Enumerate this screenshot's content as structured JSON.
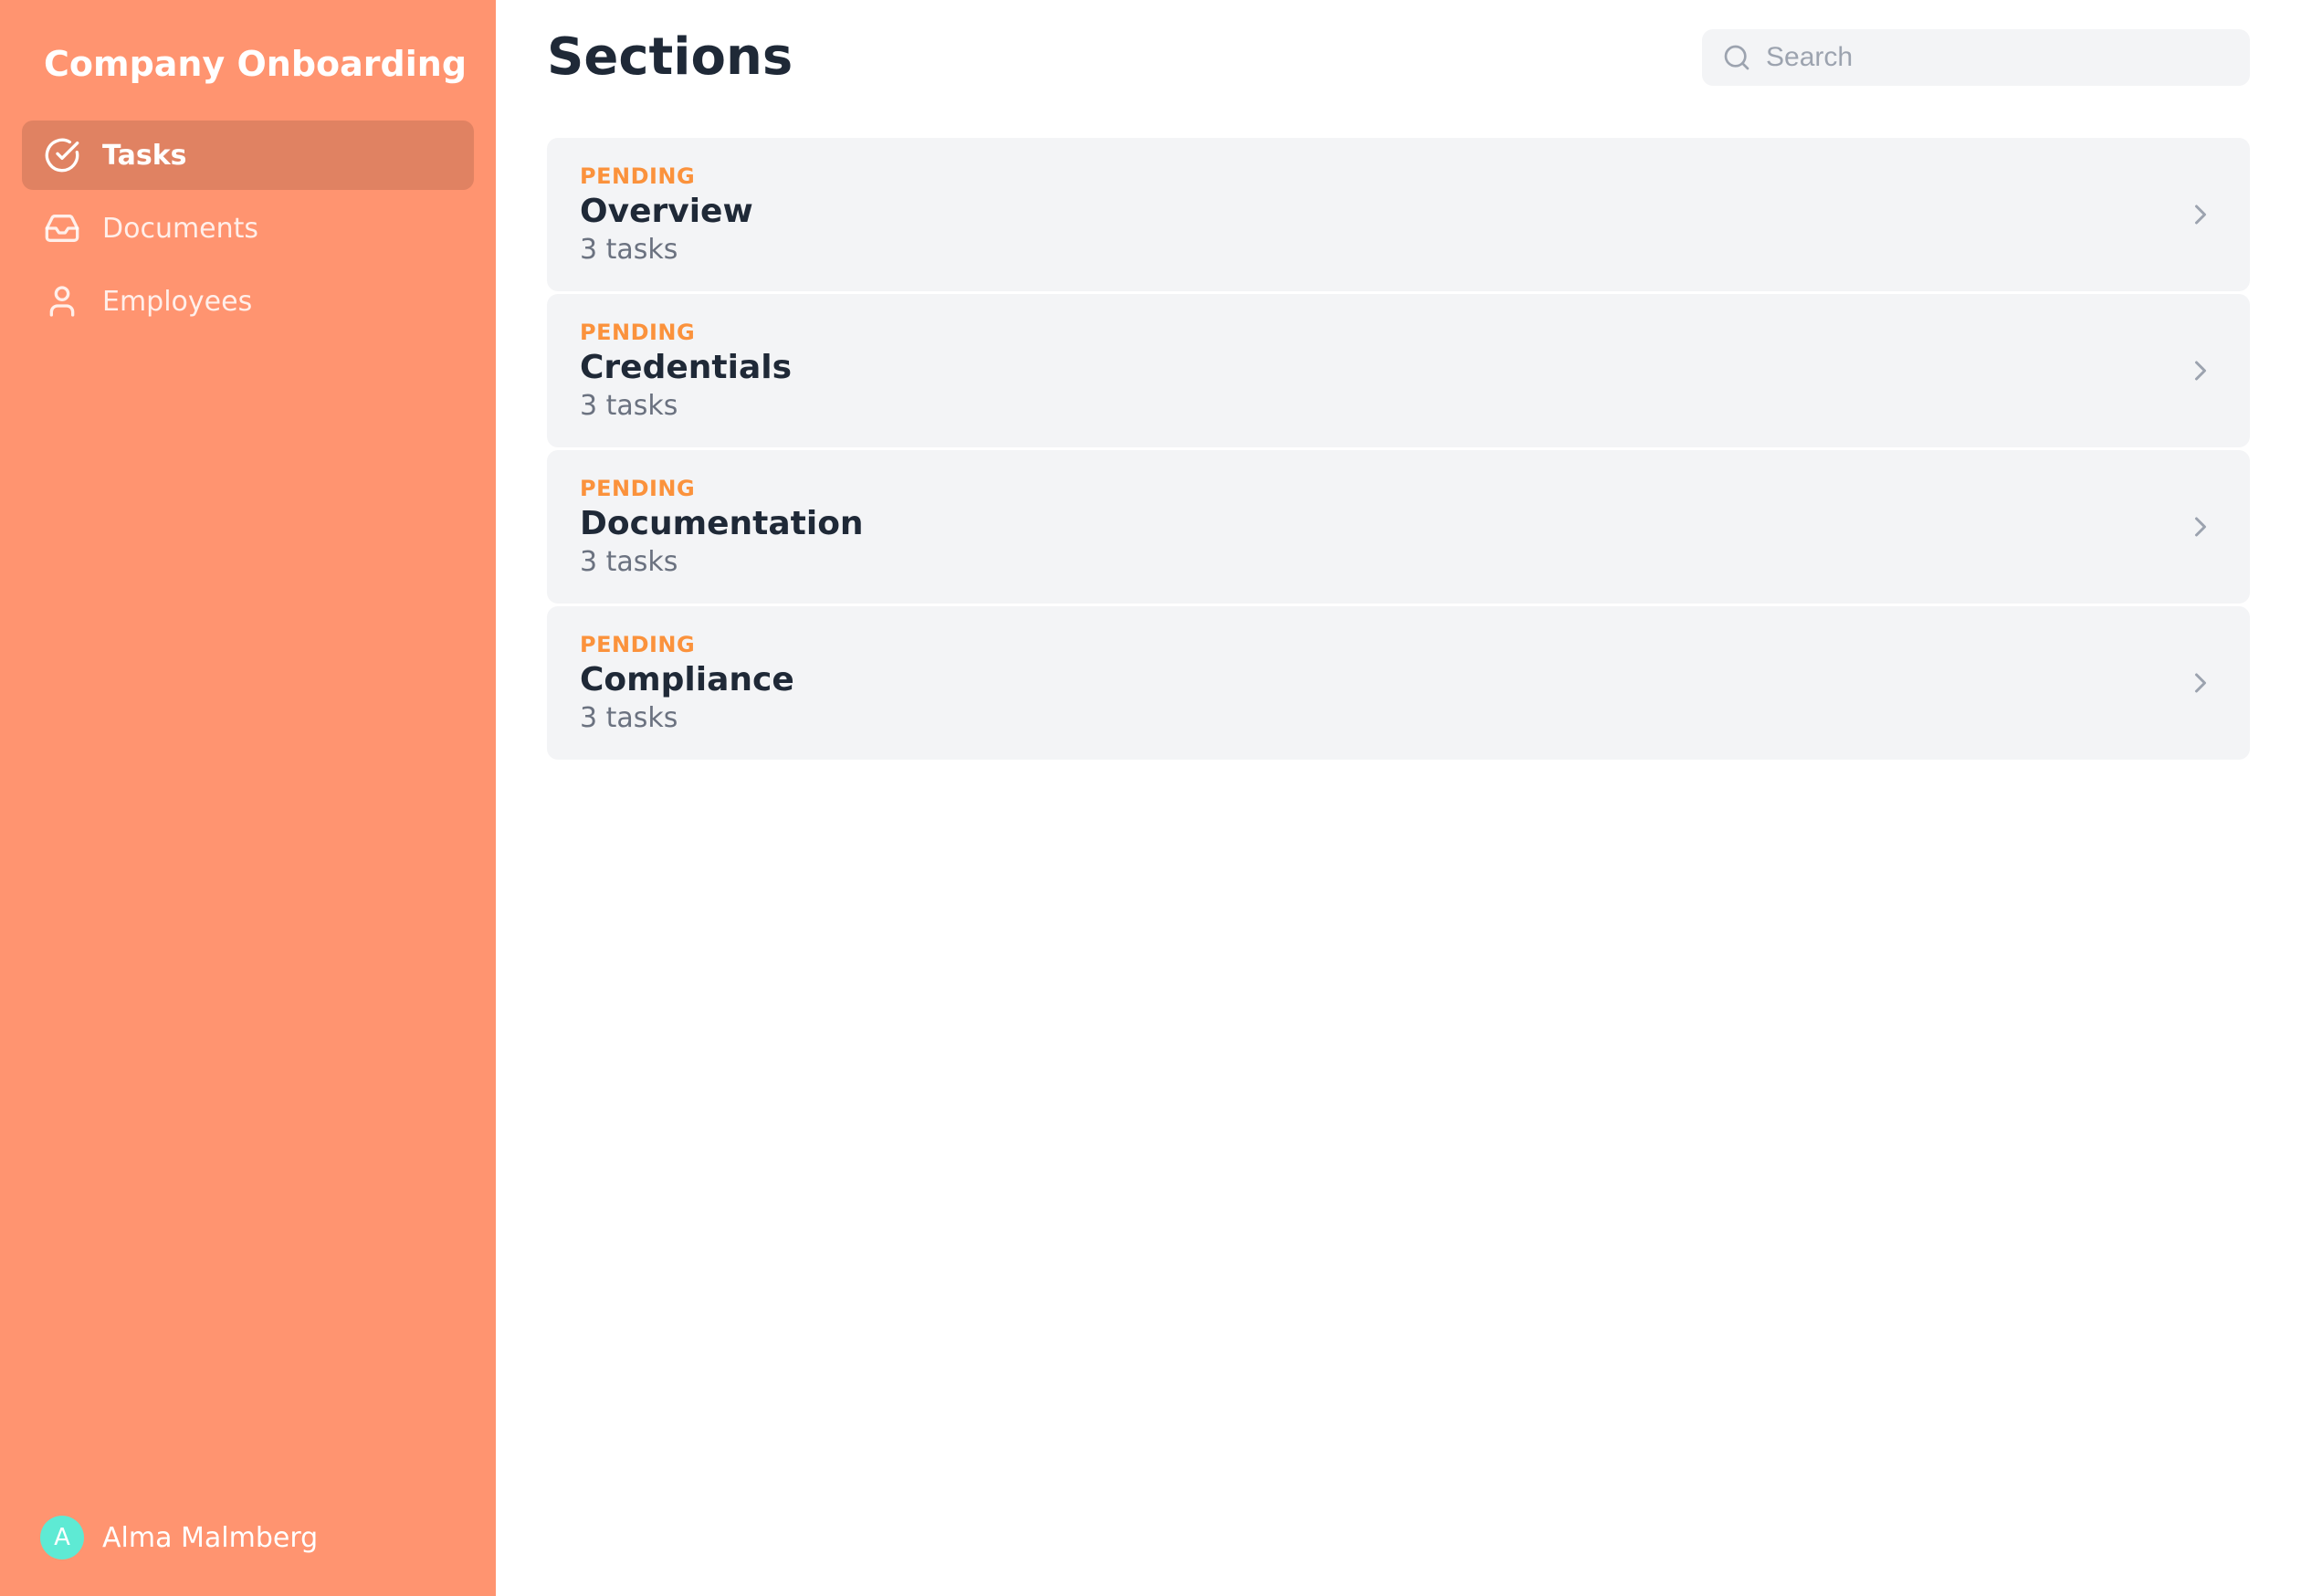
{
  "sidebar": {
    "title": "Company Onboarding",
    "items": [
      {
        "label": "Tasks",
        "icon": "check-circle",
        "active": true
      },
      {
        "label": "Documents",
        "icon": "inbox",
        "active": false
      },
      {
        "label": "Employees",
        "icon": "user",
        "active": false
      }
    ],
    "user": {
      "initial": "A",
      "name": "Alma Malmberg"
    }
  },
  "main": {
    "title": "Sections",
    "search": {
      "placeholder": "Search",
      "value": ""
    },
    "sections": [
      {
        "status": "PENDING",
        "name": "Overview",
        "tasks": "3 tasks"
      },
      {
        "status": "PENDING",
        "name": "Credentials",
        "tasks": "3 tasks"
      },
      {
        "status": "PENDING",
        "name": "Documentation",
        "tasks": "3 tasks"
      },
      {
        "status": "PENDING",
        "name": "Compliance",
        "tasks": "3 tasks"
      }
    ]
  },
  "colors": {
    "sidebarBg": "#ff9470",
    "accent": "#fb923c",
    "avatarBg": "#5eead4"
  }
}
